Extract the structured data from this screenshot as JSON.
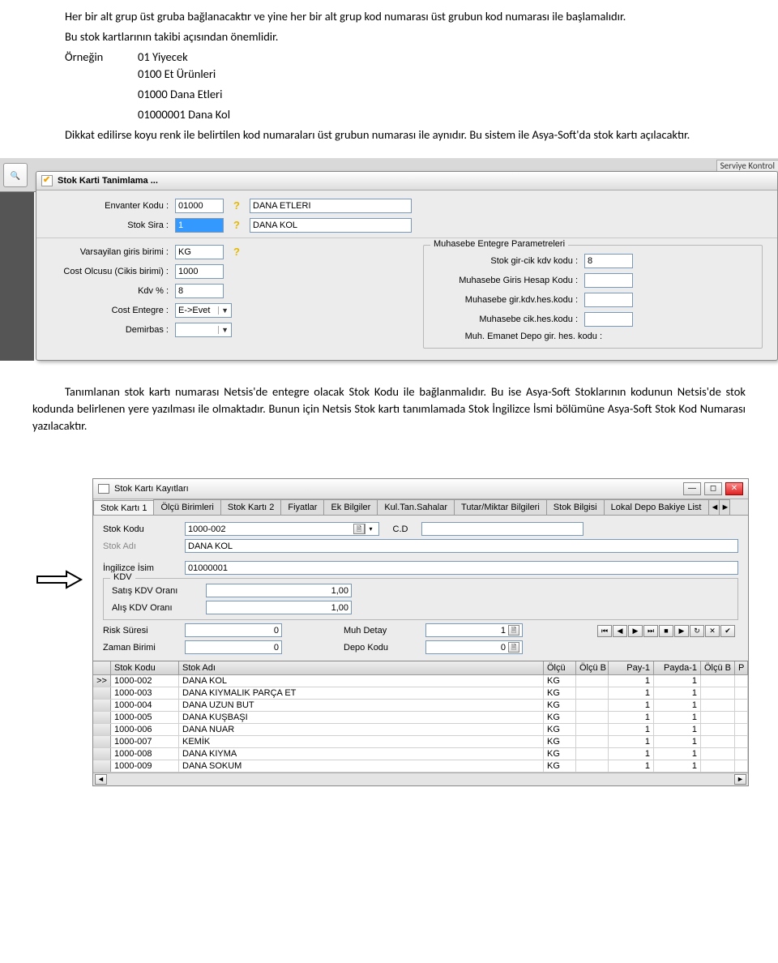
{
  "intro": {
    "p1": "Her bir alt grup üst gruba bağlanacaktır ve yine her bir alt grup kod numarası üst grubun kod numarası ile başlamalıdır.",
    "p2": "Bu stok kartlarının takibi açısından önemlidir.",
    "lead": "Örneğin",
    "ex1": "01 Yiyecek",
    "ex2": "0100 Et Ürünleri",
    "ex3": "01000 Dana Etleri",
    "ex4": "01000001 Dana Kol",
    "p3": "Dikkat edilirse koyu renk ile belirtilen kod numaraları üst grubun numarası ile aynıdır. Bu sistem ile Asya-Soft'da stok kartı açılacaktır."
  },
  "shot1": {
    "side_label": "Serviye Kontrol",
    "title": "Stok Karti Tanimlama ...",
    "labels": {
      "envanter": "Envanter Kodu :",
      "stoksira": "Stok Sira :",
      "vgbirim": "Varsayilan giris birimi :",
      "costolcu": "Cost Olcusu (Cikis birimi) :",
      "kdv": "Kdv % :",
      "costent": "Cost Entegre :",
      "demirbas": "Demirbas :"
    },
    "values": {
      "envanter_kod": "01000",
      "envanter_ad": "DANA ETLERI",
      "stoksira": "1",
      "stoksira_ad": "DANA KOL",
      "vgbirim": "KG",
      "costolcu": "1000",
      "kdv": "8",
      "costent": "E->Evet"
    },
    "group_title": "Muhasebe Entegre Parametreleri",
    "group_labels": {
      "gircik": "Stok gir-cik kdv kodu :",
      "girhes": "Muhasebe Giris Hesap Kodu :",
      "girkdv": "Muhasebe gir.kdv.hes.kodu :",
      "cikhes": "Muhasebe cik.hes.kodu :",
      "emanet": "Muh. Emanet Depo gir. hes. kodu :"
    },
    "group_values": {
      "gircik": "8"
    }
  },
  "mid_para": "Tanımlanan stok kartı numarası Netsis'de entegre olacak Stok Kodu ile bağlanmalıdır. Bu ise Asya-Soft Stoklarının kodunun Netsis'de stok kodunda belirlenen yere yazılması ile olmaktadır. Bunun için Netsis Stok kartı tanımlamada Stok İngilizce İsmi bölümüne Asya-Soft Stok Kod Numarası yazılacaktır.",
  "shot2": {
    "title": "Stok Kartı Kayıtları",
    "tabs": [
      "Stok Kartı 1",
      "Ölçü Birimleri",
      "Stok Kartı 2",
      "Fiyatlar",
      "Ek Bilgiler",
      "Kul.Tan.Sahalar",
      "Tutar/Miktar Bilgileri",
      "Stok Bilgisi",
      "Lokal Depo Bakiye List"
    ],
    "labels": {
      "stokkodu": "Stok Kodu",
      "stokadi": "Stok Adı",
      "ingisim": "İngilizce İsim",
      "kdv_group": "KDV",
      "satiskdv": "Satış KDV Oranı",
      "aliskdv": "Alış KDV Oranı",
      "risk": "Risk Süresi",
      "zaman": "Zaman Birimi",
      "muhdetay": "Muh Detay",
      "depokodu": "Depo Kodu",
      "cd": "C.D"
    },
    "values": {
      "stokkodu": "1000-002",
      "stokadi": "DANA KOL",
      "ingisim": "01000001",
      "satiskdv": "1,00",
      "aliskdv": "1,00",
      "risk": "0",
      "zaman": "0",
      "muhdetay": "1",
      "depokodu": "0"
    },
    "grid_headers": [
      "Stok Kodu",
      "Stok Adı",
      "Ölçü",
      "Ölçü B",
      "Pay-1",
      "Payda-1",
      "Ölçü B",
      "P"
    ],
    "grid": [
      {
        "kod": "1000-002",
        "ad": "DANA KOL",
        "olcu": "KG",
        "pay": "1",
        "payda": "1"
      },
      {
        "kod": "1000-003",
        "ad": "DANA KIYMALIK PARÇA ET",
        "olcu": "KG",
        "pay": "1",
        "payda": "1"
      },
      {
        "kod": "1000-004",
        "ad": "DANA UZUN BUT",
        "olcu": "KG",
        "pay": "1",
        "payda": "1"
      },
      {
        "kod": "1000-005",
        "ad": "DANA KUŞBAŞI",
        "olcu": "KG",
        "pay": "1",
        "payda": "1"
      },
      {
        "kod": "1000-006",
        "ad": "DANA NUAR",
        "olcu": "KG",
        "pay": "1",
        "payda": "1"
      },
      {
        "kod": "1000-007",
        "ad": "KEMİK",
        "olcu": "KG",
        "pay": "1",
        "payda": "1"
      },
      {
        "kod": "1000-008",
        "ad": "DANA KIYMA",
        "olcu": "KG",
        "pay": "1",
        "payda": "1"
      },
      {
        "kod": "1000-009",
        "ad": "DANA SOKUM",
        "olcu": "KG",
        "pay": "1",
        "payda": "1"
      }
    ]
  }
}
